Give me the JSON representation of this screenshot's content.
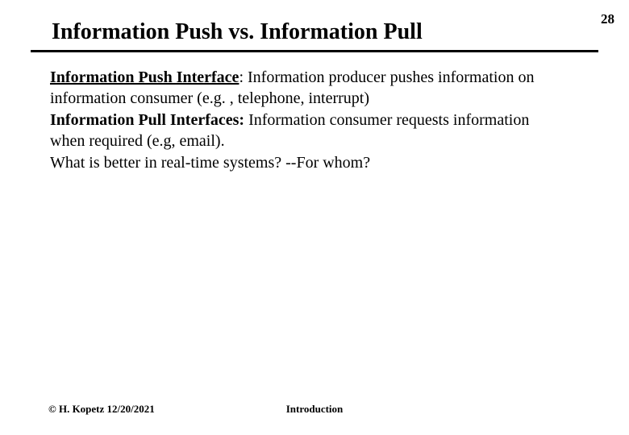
{
  "page_number": "28",
  "title": "Information Push vs. Information Pull",
  "body": {
    "para1_bold_underline": "Information Push Interface",
    "para1_rest": ":  Information producer pushes information on information consumer (e.g. , telephone, interrupt)",
    "para2_bold": "Information Pull Interfaces:",
    "para2_rest": " Information consumer requests information when  required (e.g, email).",
    "para3": "What is better in real-time systems? --For whom?"
  },
  "footer": {
    "left": "© H. Kopetz 12/20/2021",
    "center": "Introduction"
  }
}
